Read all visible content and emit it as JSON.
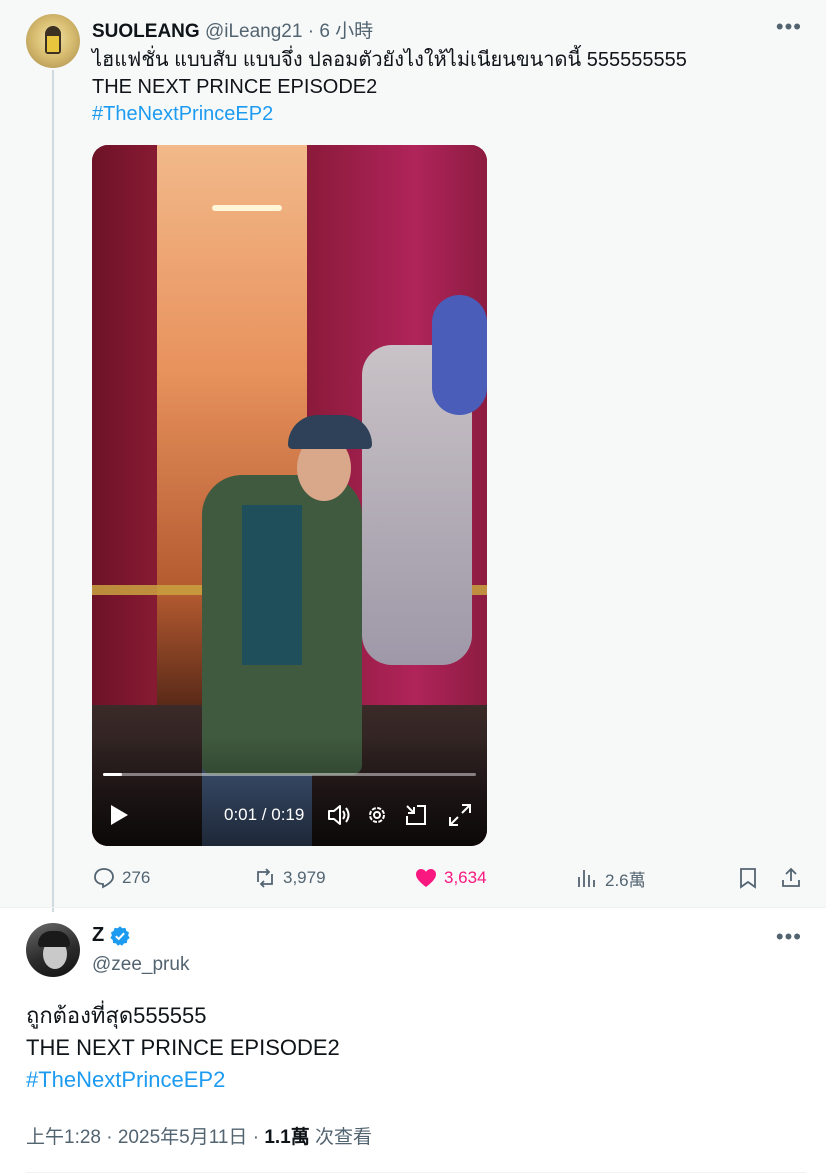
{
  "quoted_post": {
    "display_name": "SUOLEANG",
    "handle_time": "@iLeang21 · 6 小時",
    "text_line1": "ไฮแฟชั่น แบบสับ แบบจึ่ง ปลอมตัวยังไงให้ไม่เนียนขนาดนี้ 555555555",
    "text_line2": "THE NEXT PRINCE EPISODE2",
    "hashtag": "#TheNextPrinceEP2",
    "video": {
      "time": "0:01 / 0:19",
      "progress": 0.05
    },
    "actions": {
      "replies": "276",
      "reposts": "3,979",
      "likes": "3,634",
      "views": "2.6萬"
    }
  },
  "reply_post": {
    "display_name": "Z",
    "handle": "@zee_pruk",
    "text_line1": "ถูกต้องที่สุด555555",
    "text_line2": "THE NEXT PRINCE EPISODE2",
    "hashtag": "#TheNextPrinceEP2",
    "timestamp": "上午1:28 · 2025年5月11日 · ",
    "views_count": "1.1萬",
    "views_label": " 次查看"
  },
  "icons": [
    "more-icon",
    "play-icon",
    "volume-icon",
    "settings-icon",
    "minimize-icon",
    "fullscreen-icon",
    "reply-icon",
    "repost-icon",
    "like-icon",
    "views-icon",
    "bookmark-icon",
    "share-icon",
    "verified-icon"
  ],
  "colors": {
    "link": "#1d9bf0",
    "like": "#f91880",
    "muted": "#536471",
    "text": "#0f1419"
  }
}
